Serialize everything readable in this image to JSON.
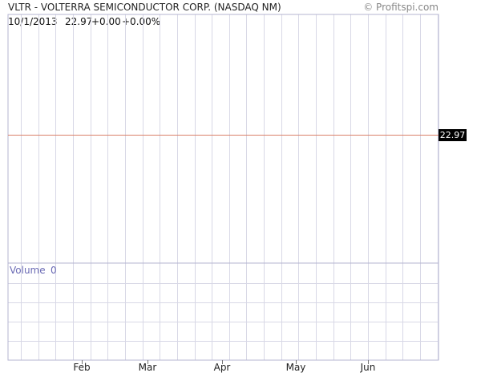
{
  "header": {
    "title": "VLTR - VOLTERRA SEMICONDUCTOR CORP. (NASDAQ NM)",
    "copyright": "© Profitspi.com"
  },
  "quote": {
    "date": "10/1/2013",
    "price": "22.97",
    "change": "+0.00",
    "change_pct": "+0.00%"
  },
  "volume": {
    "label": "Volume",
    "value": "0"
  },
  "price_label": "22.97",
  "colors": {
    "grid": "#d8d8e6",
    "frame": "#b4b4d2",
    "price_line": "#d9826a",
    "price_badge_bg": "#000000",
    "volume_text": "#6b6bb5"
  },
  "chart_data": {
    "type": "line",
    "title": "VLTR - VOLTERRA SEMICONDUCTOR CORP. (NASDAQ NM)",
    "xlabel": "",
    "ylabel": "",
    "x_ticks": [
      "Feb",
      "Mar",
      "Apr",
      "May",
      "Jun"
    ],
    "series": [
      {
        "values": [
          22.97,
          22.97
        ]
      }
    ],
    "volume_series": [
      0
    ],
    "grid": true
  }
}
